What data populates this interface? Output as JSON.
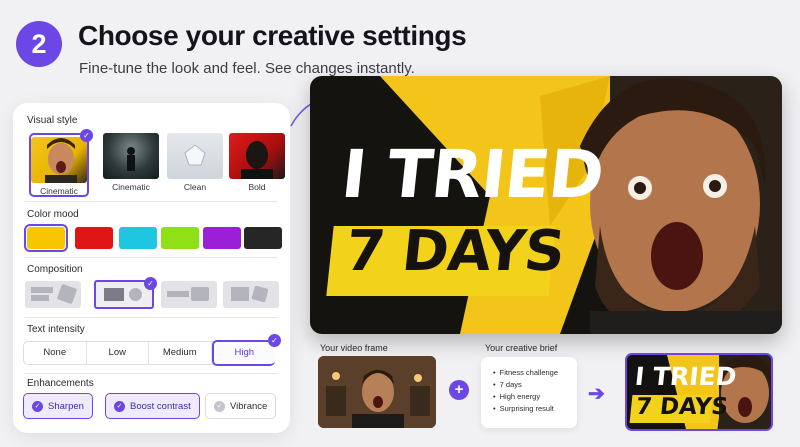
{
  "header": {
    "step_number": "2",
    "title": "Choose your creative settings",
    "subtitle": "Fine-tune the look and feel. See changes instantly."
  },
  "panel": {
    "visual_style": {
      "title": "Visual style",
      "options": [
        {
          "label": "Cinematic",
          "selected": true
        },
        {
          "label": "Cinematic",
          "selected": false
        },
        {
          "label": "Clean",
          "selected": false
        },
        {
          "label": "Bold",
          "selected": false
        }
      ]
    },
    "color_mood": {
      "title": "Color mood",
      "swatches": [
        "#f7c600",
        "#e01616",
        "#1fc6e2",
        "#8fe016",
        "#9b1fd6",
        "#262626"
      ],
      "selected_index": 0
    },
    "composition": {
      "title": "Composition",
      "selected_index": 1
    },
    "text_intensity": {
      "title": "Text intensity",
      "options": [
        "None",
        "Low",
        "Medium",
        "High"
      ],
      "selected": "High"
    },
    "enhancements": {
      "title": "Enhancements",
      "chips": [
        {
          "label": "Sharpen",
          "on": true
        },
        {
          "label": "Boost contrast",
          "on": true
        },
        {
          "label": "Vibrance",
          "on": false
        }
      ]
    }
  },
  "preview": {
    "line1": "I TRIED",
    "line2": "7 DAYS",
    "accent": "#f3d21c"
  },
  "pipeline": {
    "frame_caption": "Your video frame",
    "brief_caption": "Your creative brief",
    "brief_items": [
      "Fitness challenge",
      "7 days",
      "High energy",
      "Surprising result"
    ],
    "plus": "+",
    "arrow": "➔",
    "result_line1": "I TRIED",
    "result_line2": "7 DAYS"
  },
  "colors": {
    "accent": "#6c47e6",
    "yellow": "#f3d21c"
  }
}
